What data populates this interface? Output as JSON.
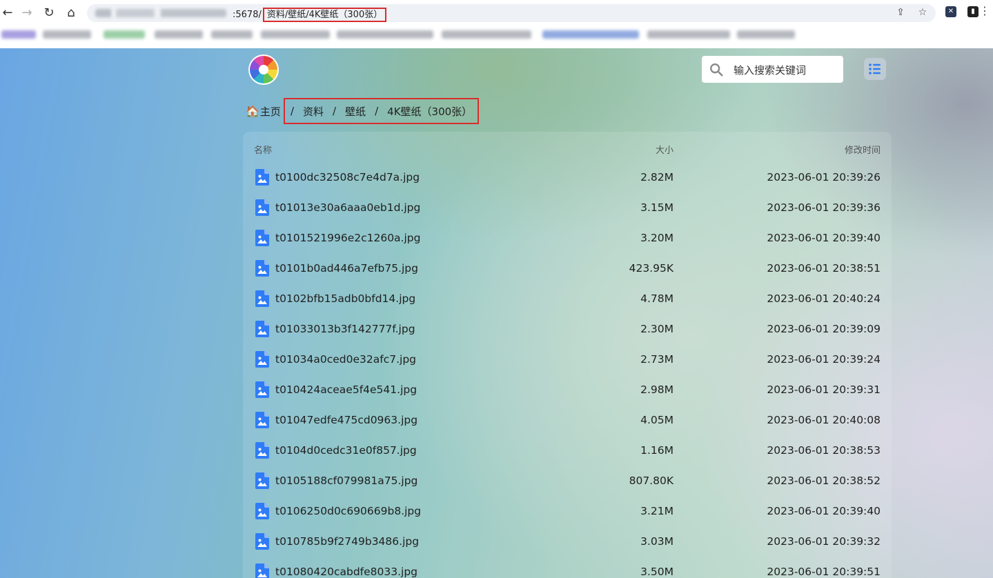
{
  "browser": {
    "url_visible": ":5678/",
    "url_path": "资料/壁纸/4K壁纸（300张）"
  },
  "header": {
    "search_placeholder": "输入搜索关键词"
  },
  "breadcrumb": {
    "home": "主页",
    "items": [
      "资料",
      "壁纸",
      "4K壁纸（300张）"
    ],
    "separator": "/"
  },
  "table": {
    "columns": [
      "名称",
      "大小",
      "修改时间"
    ],
    "rows": [
      {
        "name": "t0100dc32508c7e4d7a.jpg",
        "size": "2.82M",
        "time": "2023-06-01 20:39:26"
      },
      {
        "name": "t01013e30a6aaa0eb1d.jpg",
        "size": "3.15M",
        "time": "2023-06-01 20:39:36"
      },
      {
        "name": "t0101521996e2c1260a.jpg",
        "size": "3.20M",
        "time": "2023-06-01 20:39:40"
      },
      {
        "name": "t0101b0ad446a7efb75.jpg",
        "size": "423.95K",
        "time": "2023-06-01 20:38:51"
      },
      {
        "name": "t0102bfb15adb0bfd14.jpg",
        "size": "4.78M",
        "time": "2023-06-01 20:40:24"
      },
      {
        "name": "t01033013b3f142777f.jpg",
        "size": "2.30M",
        "time": "2023-06-01 20:39:09"
      },
      {
        "name": "t01034a0ced0e32afc7.jpg",
        "size": "2.73M",
        "time": "2023-06-01 20:39:24"
      },
      {
        "name": "t010424aceae5f4e541.jpg",
        "size": "2.98M",
        "time": "2023-06-01 20:39:31"
      },
      {
        "name": "t01047edfe475cd0963.jpg",
        "size": "4.05M",
        "time": "2023-06-01 20:40:08"
      },
      {
        "name": "t0104d0cedc31e0f857.jpg",
        "size": "1.16M",
        "time": "2023-06-01 20:38:53"
      },
      {
        "name": "t0105188cf079981a75.jpg",
        "size": "807.80K",
        "time": "2023-06-01 20:38:52"
      },
      {
        "name": "t0106250d0c690669b8.jpg",
        "size": "3.21M",
        "time": "2023-06-01 20:39:40"
      },
      {
        "name": "t010785b9f2749b3486.jpg",
        "size": "3.03M",
        "time": "2023-06-01 20:39:32"
      },
      {
        "name": "t01080420cabdfe8033.jpg",
        "size": "3.50M",
        "time": "2023-06-01 20:39:51"
      }
    ]
  },
  "colors": {
    "accent_blue": "#2f7cf6",
    "highlight_red": "#d92c2c"
  }
}
